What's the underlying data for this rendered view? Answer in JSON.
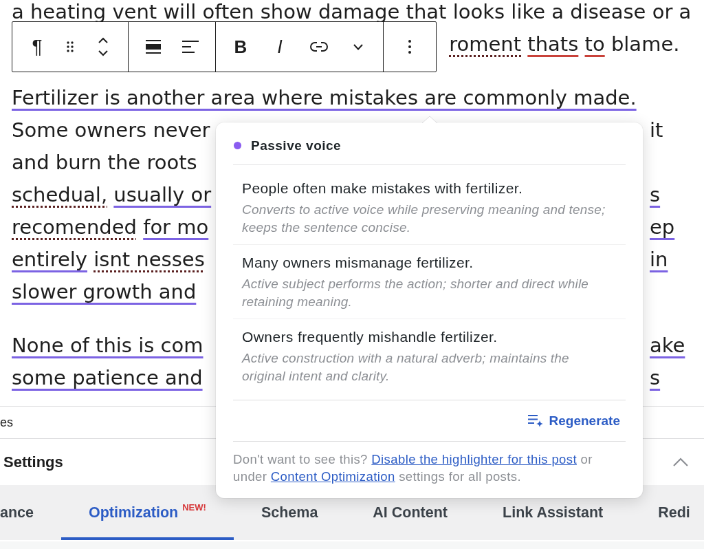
{
  "editor": {
    "paragraphs": [
      {
        "lines": [
          {
            "left": [
              {
                "text": "a heating vent will often show damage that looks like a disease or a"
              }
            ]
          },
          {
            "kind": "tail",
            "right": [
              {
                "text": "roment",
                "kind": "spelling"
              },
              {
                "text": "thats",
                "kind": "grammar"
              },
              {
                "text": "to",
                "kind": "grammar"
              },
              {
                "text": "blame."
              }
            ]
          }
        ]
      },
      {
        "lines": [
          {
            "left": [
              {
                "text": "Fertilizer is another area where mistakes are commonly made.",
                "kind": "highlight"
              }
            ]
          },
          {
            "kind": "split",
            "left": [
              {
                "text": "Some owners never"
              }
            ],
            "right": [
              {
                "text": "it"
              }
            ]
          },
          {
            "kind": "split",
            "left": [
              {
                "text": "and burn the roots"
              }
            ]
          },
          {
            "kind": "split",
            "left": [
              {
                "text": "schedual,",
                "kind": "spelling"
              },
              {
                "text": "usually or",
                "kind": "highlight"
              }
            ],
            "right": [
              {
                "text": "s",
                "kind": "highlight"
              }
            ]
          },
          {
            "kind": "split",
            "left": [
              {
                "text": "recomended",
                "kind": "spelling"
              },
              {
                "text": "for mo",
                "kind": "highlight"
              }
            ],
            "right": [
              {
                "text": "ep",
                "kind": "highlight"
              }
            ]
          },
          {
            "kind": "split",
            "left": [
              {
                "text": "entirely",
                "kind": "highlight"
              },
              {
                "text": "isnt nesses",
                "kind": "spelling"
              }
            ],
            "right": [
              {
                "text": "in",
                "kind": "highlight"
              }
            ]
          },
          {
            "kind": "split",
            "left": [
              {
                "text": "slower growth and",
                "kind": "highlight"
              }
            ]
          }
        ]
      },
      {
        "lines": [
          {
            "kind": "split",
            "left": [
              {
                "text": "None of this is com",
                "kind": "highlight"
              }
            ],
            "right": [
              {
                "text": "ake",
                "kind": "highlight"
              }
            ]
          },
          {
            "kind": "split",
            "left": [
              {
                "text": "some patience and",
                "kind": "highlight"
              }
            ],
            "right": [
              {
                "text": "s",
                "kind": "highlight"
              }
            ]
          }
        ]
      }
    ]
  },
  "block_toolbar": {
    "groups": [
      {
        "buttons": [
          {
            "kind": "paragraph",
            "label": "¶"
          },
          {
            "kind": "drag"
          },
          {
            "kind": "move"
          }
        ]
      },
      {
        "buttons": [
          {
            "kind": "block-align"
          },
          {
            "kind": "text-align"
          }
        ]
      },
      {
        "buttons": [
          {
            "kind": "bold",
            "label": "B"
          },
          {
            "kind": "italic",
            "label": "I"
          },
          {
            "kind": "link"
          },
          {
            "kind": "more"
          }
        ]
      },
      {
        "buttons": [
          {
            "kind": "options"
          }
        ]
      }
    ]
  },
  "popover": {
    "issue": "Passive voice",
    "suggestions": [
      {
        "text": "People often make mistakes with fertilizer.",
        "note": "Converts to active voice while preserving meaning and tense; keeps the sentence concise."
      },
      {
        "text": "Many owners mismanage fertilizer.",
        "note": "Active subject performs the action; shorter and direct while retaining meaning."
      },
      {
        "text": "Owners frequently mishandle fertilizer.",
        "note": "Active construction with a natural adverb; maintains the original intent and clarity."
      }
    ],
    "regenerate": "Regenerate",
    "footer": [
      {
        "text": "Don't want to see this? "
      },
      {
        "text": "Disable the highlighter for this post",
        "kind": "link"
      },
      {
        "text": " or under "
      },
      {
        "text": "Content Optimization",
        "kind": "link"
      },
      {
        "text": " settings for all posts."
      }
    ]
  },
  "panel": {
    "row": "es",
    "section": {
      "title": "Settings",
      "expanded": true
    },
    "tabs": [
      {
        "label": "ance",
        "selected": false
      },
      {
        "label": "Optimization",
        "badge": "NEW!",
        "selected": true
      },
      {
        "label": "Schema",
        "selected": false
      },
      {
        "label": "AI Content",
        "selected": false
      },
      {
        "label": "Link Assistant",
        "selected": false
      },
      {
        "label": "Redi",
        "selected": false
      }
    ]
  }
}
